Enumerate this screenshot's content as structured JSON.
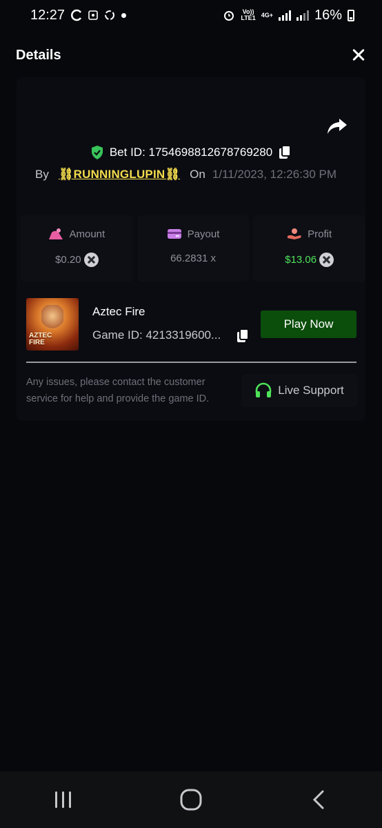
{
  "status_bar": {
    "time": "12:27",
    "network_top": "Vo))",
    "network_bottom": "LTE1",
    "network_type": "4G+",
    "battery": "16%"
  },
  "header": {
    "title": "Details"
  },
  "bet": {
    "id_label": "Bet ID: 1754698812678769280",
    "by_label": "By",
    "username": "⛓RUNNINGLUPIN⛓",
    "on_label": "On",
    "datetime": "1/11/2023, 12:26:30 PM"
  },
  "stats": {
    "amount_label": "Amount",
    "amount_value": "$0.20",
    "payout_label": "Payout",
    "payout_value": "66.2831 x",
    "profit_label": "Profit",
    "profit_value": "$13.06"
  },
  "game": {
    "name": "Aztec Fire",
    "id": "Game ID: 4213319600...",
    "thumb_text_1": "AZTEC",
    "thumb_text_2": "FIRE",
    "play_label": "Play Now"
  },
  "support": {
    "help_text": "Any issues, please contact the customer service for help and provide the game ID.",
    "button_label": "Live Support"
  },
  "colors": {
    "background": "#07080c",
    "accent_green": "#4ee35a",
    "play_button": "#0b4d0b",
    "username": "#f3dc4c"
  },
  "icons": [
    "shield-check-icon",
    "copy-icon",
    "share-icon",
    "amount-icon",
    "payout-card-icon",
    "profit-hand-icon",
    "coin-icon",
    "headset-icon",
    "close-icon"
  ]
}
